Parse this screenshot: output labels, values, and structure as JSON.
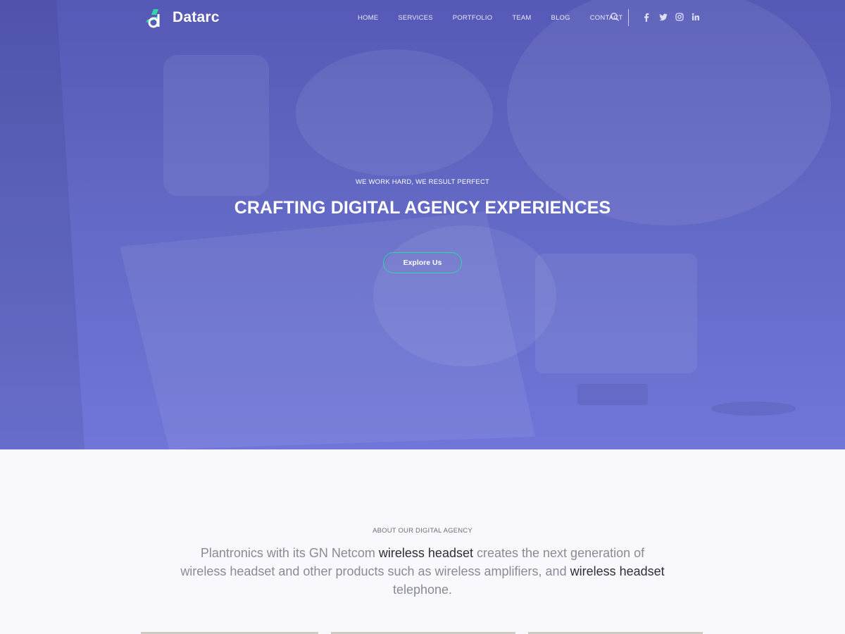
{
  "brand": {
    "name": "Datarc",
    "accent": "#2fd5a6"
  },
  "nav": {
    "items": [
      "HOME",
      "SERVICES",
      "PORTFOLIO",
      "TEAM",
      "BLOG",
      "CONTACT"
    ],
    "search_icon": "search-icon",
    "social_icons": [
      "facebook-icon",
      "twitter-icon",
      "instagram-icon",
      "linkedin-icon"
    ]
  },
  "hero": {
    "kicker": "WE WORK HARD, WE RESULT PERFECT",
    "title": "CRAFTING DIGITAL AGENCY EXPERIENCES",
    "cta_label": "Explore Us",
    "overlay_color": "#6268c4"
  },
  "about": {
    "kicker": "ABOUT OUR DIGITAL AGENCY",
    "body": {
      "p1": "Plantronics with its GN Netcom ",
      "h1": "wireless headset",
      "p2": " creates the next generation of wireless headset and other products such as wireless amplifiers, and ",
      "h2": "wireless headset",
      "p3": " telephone."
    }
  }
}
